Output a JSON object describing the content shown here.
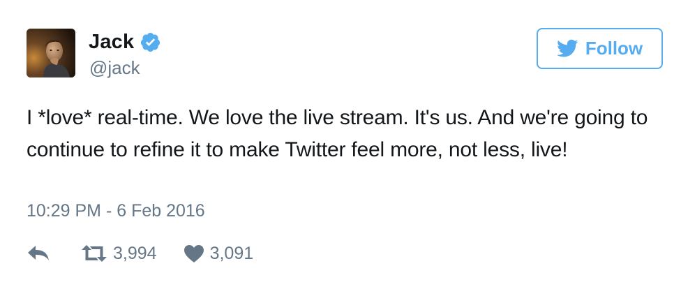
{
  "author": {
    "display_name": "Jack",
    "handle": "@jack",
    "verified": true
  },
  "follow_button": {
    "label": "Follow"
  },
  "tweet": {
    "text": "I *love* real-time. We love the live stream. It's us. And we're going to continue to refine it to make Twitter feel more, not less, live!",
    "timestamp": "10:29 PM - 6 Feb 2016"
  },
  "actions": {
    "reply_icon": "reply-icon",
    "retweet_icon": "retweet-icon",
    "retweet_count": "3,994",
    "like_icon": "heart-icon",
    "like_count": "3,091"
  },
  "colors": {
    "brand_blue": "#55acee",
    "text_primary": "#14171a",
    "text_secondary": "#657786"
  }
}
